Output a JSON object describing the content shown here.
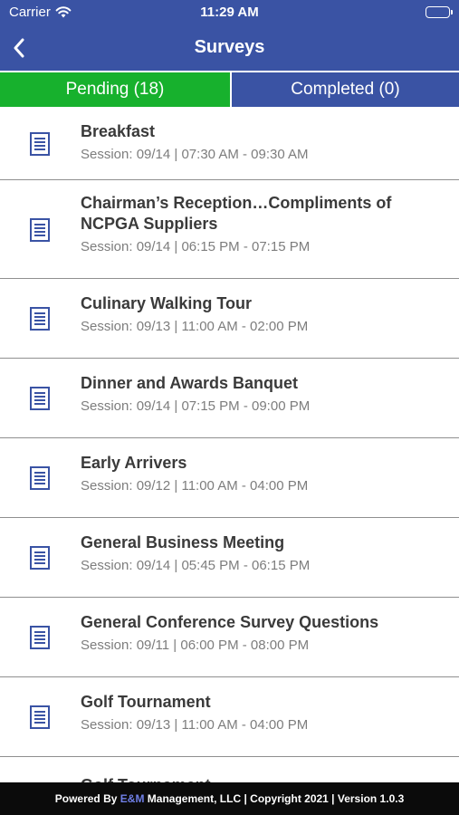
{
  "status_bar": {
    "carrier": "Carrier",
    "time": "11:29 AM"
  },
  "nav": {
    "title": "Surveys"
  },
  "tabs": [
    {
      "label": "Pending (18)",
      "active": true
    },
    {
      "label": "Completed (0)",
      "active": false
    }
  ],
  "surveys": [
    {
      "name": "Breakfast",
      "session": "Session: 09/14 | 07:30 AM - 09:30 AM"
    },
    {
      "name": "Chairman’s Reception…Compliments of NCPGA Suppliers",
      "session": "Session: 09/14 | 06:15 PM - 07:15 PM"
    },
    {
      "name": "Culinary Walking Tour",
      "session": "Session: 09/13 | 11:00 AM - 02:00 PM"
    },
    {
      "name": "Dinner and Awards Banquet",
      "session": "Session: 09/14 | 07:15 PM - 09:00 PM"
    },
    {
      "name": "Early Arrivers",
      "session": "Session: 09/12 | 11:00 AM - 04:00 PM"
    },
    {
      "name": "General Business Meeting",
      "session": "Session: 09/14 | 05:45 PM - 06:15 PM"
    },
    {
      "name": "General Conference Survey Questions",
      "session": "Session: 09/11 | 06:00 PM - 08:00 PM"
    },
    {
      "name": "Golf Tournament",
      "session": "Session: 09/13 | 11:00 AM - 04:00 PM"
    },
    {
      "name": "Golf Tournament",
      "session": ""
    }
  ],
  "footer": {
    "prefix": "Powered By ",
    "brand": "E&M",
    "suffix": " Management, LLC | Copyright 2021 | Version 1.0.3"
  },
  "colors": {
    "header": "#3a53a4",
    "tab_active": "#17b12d",
    "footer": "#0b0b0b",
    "icon": "#3a53a4"
  }
}
